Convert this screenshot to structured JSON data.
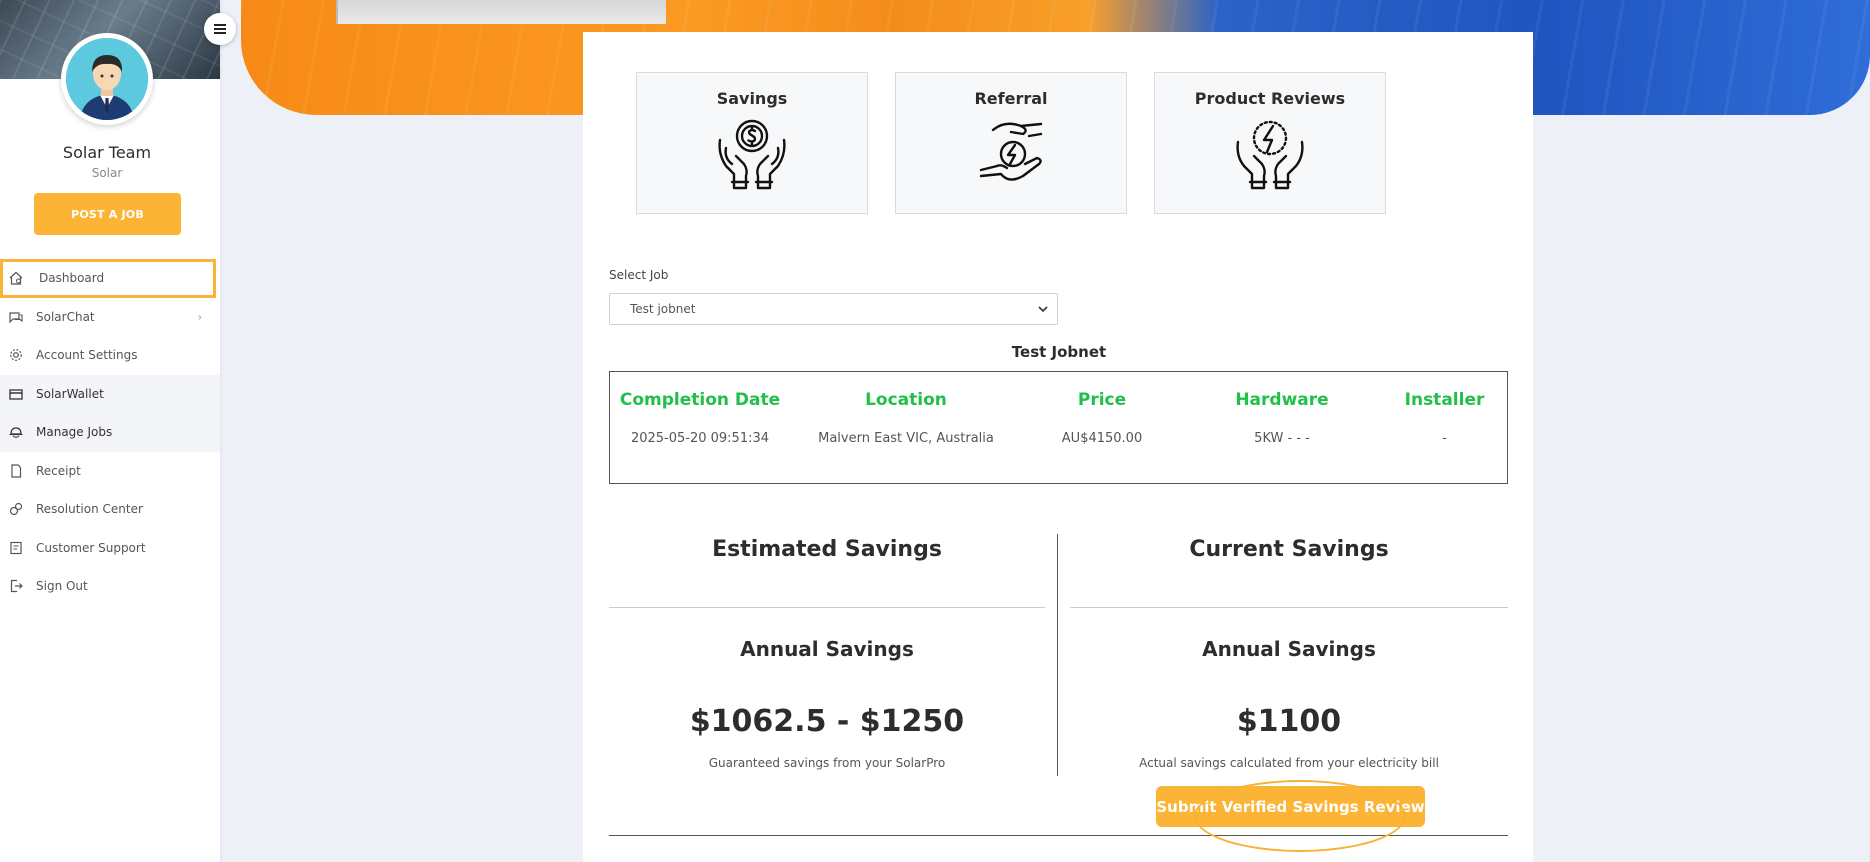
{
  "sidebar": {
    "user_name": "Solar Team",
    "user_role": "Solar",
    "post_job_label": "POST A JOB",
    "items": [
      {
        "label": "Dashboard",
        "icon": "home-icon"
      },
      {
        "label": "SolarChat",
        "icon": "chat-icon"
      },
      {
        "label": "Account Settings",
        "icon": "gear-icon"
      },
      {
        "label": "SolarWallet",
        "icon": "wallet-icon"
      },
      {
        "label": "Manage Jobs",
        "icon": "hardhat-icon"
      },
      {
        "label": "Receipt",
        "icon": "document-icon"
      },
      {
        "label": "Resolution Center",
        "icon": "resolution-icon"
      },
      {
        "label": "Customer Support",
        "icon": "support-icon"
      },
      {
        "label": "Sign Out",
        "icon": "signout-icon"
      }
    ]
  },
  "tiles": [
    {
      "title": "Savings",
      "icon": "hands-coin-icon"
    },
    {
      "title": "Referral",
      "icon": "hands-energy-icon"
    },
    {
      "title": "Product Reviews",
      "icon": "hands-lightning-icon"
    }
  ],
  "job_select": {
    "label": "Select Job",
    "value": "Test jobnet"
  },
  "job": {
    "name": "Test Jobnet",
    "headers": [
      "Completion Date",
      "Location",
      "Price",
      "Hardware",
      "Installer"
    ],
    "values": [
      "2025-05-20 09:51:34",
      "Malvern East VIC, Australia",
      "AU$4150.00",
      "5KW - - -",
      "-"
    ]
  },
  "estimated": {
    "heading": "Estimated Savings",
    "annual_label": "Annual Savings",
    "amount": "$1062.5 - $1250",
    "note": "Guaranteed savings from your SolarPro"
  },
  "current": {
    "heading": "Current Savings",
    "annual_label": "Annual Savings",
    "amount": "$1100",
    "note": "Actual savings calculated from your electricity bill",
    "submit_label": "Submit Verified Savings Review"
  },
  "colors": {
    "accent": "#fbb436",
    "header_green": "#22c04a",
    "page_bg": "#eef0f8"
  }
}
